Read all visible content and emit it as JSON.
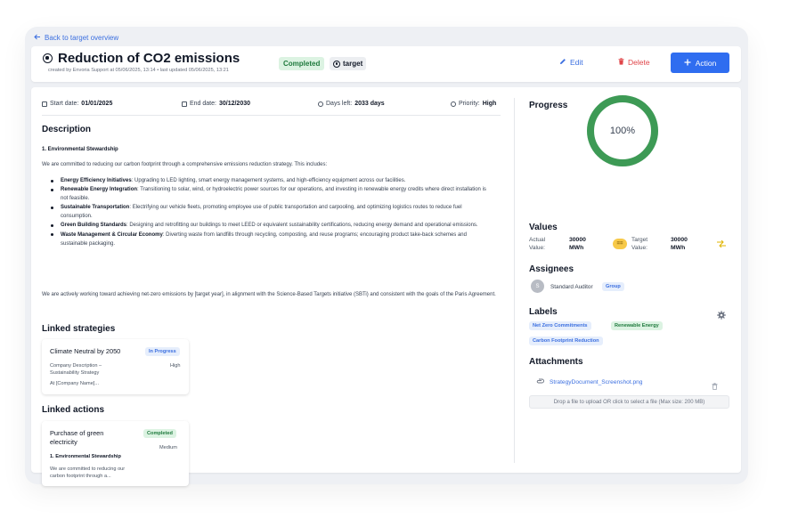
{
  "nav": {
    "back_label": "Back to target overview"
  },
  "header": {
    "title": "Reduction of CO2 emissions",
    "subtitle": "created by Envoria Support at 05/06/2025, 13:14 • last updated 05/06/2025, 13:21",
    "status_badge": "Completed",
    "type_badge": "target",
    "edit_label": "Edit",
    "delete_label": "Delete",
    "action_label": "Action"
  },
  "meta": {
    "start_label": "Start date:",
    "start_value": "01/01/2025",
    "end_label": "End date:",
    "end_value": "30/12/2030",
    "days_label": "Days left:",
    "days_value": "2033 days",
    "priority_label": "Priority:",
    "priority_value": "High"
  },
  "description": {
    "heading": "Description",
    "subheading": "1. Environmental Stewardship",
    "intro": "We are committed to reducing our carbon footprint through a comprehensive emissions reduction strategy. This includes:",
    "bullets": [
      {
        "bold": "Energy Efficiency Initiatives",
        "text": ": Upgrading to LED lighting, smart energy management systems, and high-efficiency equipment across our facilities."
      },
      {
        "bold": "Renewable Energy Integration",
        "text": ": Transitioning to solar, wind, or hydroelectric power sources for our operations, and investing in renewable energy credits where direct installation is not feasible."
      },
      {
        "bold": "Sustainable Transportation",
        "text": ": Electrifying our vehicle fleets, promoting employee use of public transportation and carpooling, and optimizing logistics routes to reduce fuel consumption."
      },
      {
        "bold": "Green Building Standards",
        "text": ": Designing and retrofitting our buildings to meet LEED or equivalent sustainability certifications, reducing energy demand and operational emissions."
      },
      {
        "bold": "Waste Management & Circular Economy",
        "text": ": Diverting waste from landfills through recycling, composting, and reuse programs; encouraging product take-back schemes and sustainable packaging."
      }
    ],
    "outro": "We are actively working toward achieving net-zero emissions by [target year], in alignment with the Science-Based Targets initiative (SBTi) and consistent with the goals of the Paris Agreement."
  },
  "linked_strategies": {
    "heading": "Linked strategies",
    "card": {
      "title": "Climate Neutral by 2050",
      "status": "In Progress",
      "desc": "Company Description – Sustainability Strategy",
      "priority": "High",
      "extra": "At [Company Name]..."
    }
  },
  "linked_actions": {
    "heading": "Linked actions",
    "card": {
      "title": "Purchase of green electricity",
      "status": "Completed",
      "priority": "Medium",
      "sub": "1. Environmental Stewardship",
      "desc": "We are committed to reducing our carbon footprint through a..."
    }
  },
  "progress": {
    "heading": "Progress",
    "value_label": "100%",
    "fraction": 1.0,
    "color": "#3d9a55"
  },
  "values": {
    "heading": "Values",
    "actual_label": "Actual Value:",
    "actual_value": "30000 MWh",
    "eq_badge": "==",
    "target_label": "Target Value:",
    "target_value": "30000 MWh"
  },
  "assignees": {
    "heading": "Assignees",
    "initial": "S",
    "name": "Standard Auditor",
    "tag": "Group"
  },
  "labels": {
    "heading": "Labels",
    "items": [
      "Net Zero Commitments",
      "Renewable Energy",
      "Carbon Footprint Reduction"
    ]
  },
  "attachments": {
    "heading": "Attachments",
    "file": "StrategyDocument_Screenshot.png",
    "dropzone": "Drop a file to upload OR click to select a file (Max size: 200 MB)"
  }
}
